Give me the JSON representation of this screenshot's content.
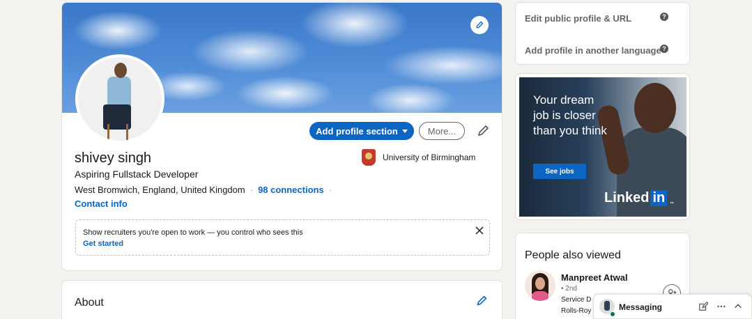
{
  "profile": {
    "name": "shivey singh",
    "headline": "Aspiring Fullstack Developer",
    "location": "West Bromwich, England, United Kingdom",
    "connections": "98 connections",
    "contact_info": "Contact info",
    "school": "University of Birmingham",
    "add_section_label": "Add profile section",
    "more_label": "More..."
  },
  "open_to_work": {
    "text": "Show recruiters you're open to work — you control who sees this",
    "link": "Get started"
  },
  "about": {
    "title": "About"
  },
  "settings": {
    "edit_public_profile": "Edit public profile & URL",
    "add_language": "Add profile in another language",
    "help_glyph": "?"
  },
  "ad": {
    "headline": "Your dream job is closer than you think",
    "cta": "See jobs",
    "brand_prefix": "Linked",
    "brand_in": "in",
    "brand_mark": "™"
  },
  "people_also_viewed": {
    "title": "People also viewed",
    "person": {
      "name": "Manpreet Atwal",
      "degree": "• 2nd",
      "line1": "Service D",
      "line2": "Rolls-Roy"
    }
  },
  "messaging": {
    "label": "Messaging"
  },
  "colors": {
    "accent": "#0a66c2",
    "background": "#f3f2ef",
    "online": "#057642"
  }
}
